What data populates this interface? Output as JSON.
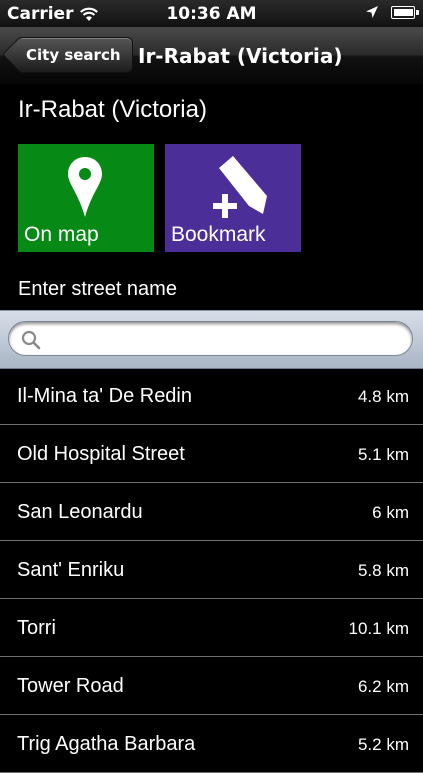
{
  "status": {
    "carrier": "Carrier",
    "time": "10:36 AM",
    "battery_level": 0.85
  },
  "nav": {
    "back_label": "City search",
    "title": "Ir-Rabat (Victoria)"
  },
  "city_title": "Ir-Rabat (Victoria)",
  "tiles": {
    "map": {
      "label": "On map",
      "icon": "map-pin-icon",
      "color": "#068a15"
    },
    "bookmark": {
      "label": "Bookmark",
      "icon": "bookmark-add-icon",
      "color": "#4b2e98"
    }
  },
  "search": {
    "label": "Enter street name",
    "value": "",
    "placeholder": ""
  },
  "streets": [
    {
      "name": "Il-Mina ta' De Redin",
      "distance": "4.8 km"
    },
    {
      "name": "Old Hospital Street",
      "distance": "5.1 km"
    },
    {
      "name": "San Leonardu",
      "distance": "6 km"
    },
    {
      "name": "Sant' Enriku",
      "distance": "5.8 km"
    },
    {
      "name": "Torri",
      "distance": "10.1 km"
    },
    {
      "name": "Tower Road",
      "distance": "6.2 km"
    },
    {
      "name": "Trig Agatha Barbara",
      "distance": "5.2 km"
    }
  ]
}
